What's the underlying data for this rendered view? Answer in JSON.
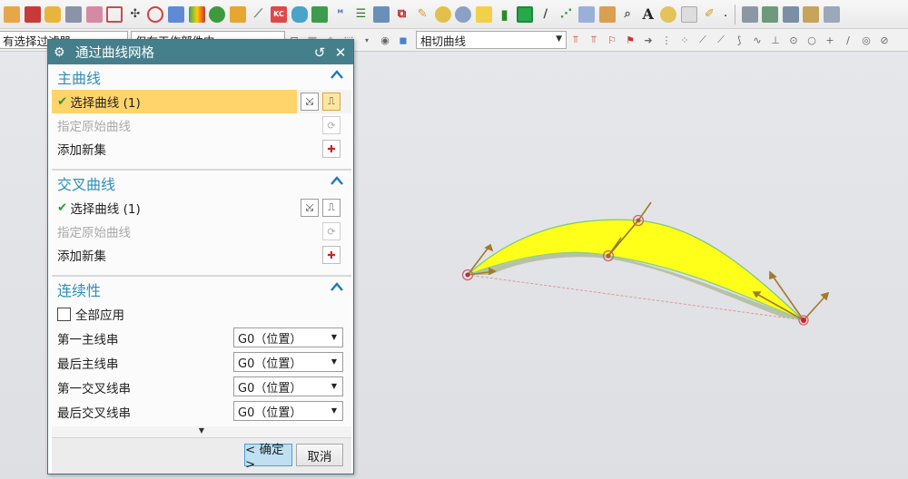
{
  "toolbar_row1": {
    "icons": [
      "feature-icon",
      "block-icon",
      "cylinder-icon",
      "extrude-icon",
      "revolve-icon",
      "sketch-icon",
      "datum-icon",
      "point-icon",
      "bridge-icon",
      "sphere-icon",
      "edge-blend-icon",
      "chamfer-icon",
      "kc-icon",
      "curve-icon",
      "transform-icon",
      "offset-icon",
      "hole-icon",
      "thread-icon",
      "boolean-icon",
      "unite-icon",
      "shell-icon",
      "pattern-icon",
      "mirror-icon",
      "trim-icon",
      "box-icon",
      "rectangle-icon",
      "line-icon",
      "arc-icon",
      "table-icon",
      "surface-icon",
      "analyze-icon",
      "text-icon",
      "paint-icon",
      "view-icon",
      "brush-icon"
    ],
    "text_icon_glyph": "A",
    "right_icons": [
      "layer-icon",
      "layer-stack-icon",
      "layer-settings-icon",
      "view-layer-icon",
      "view-style-icon"
    ]
  },
  "toolbar_row2": {
    "filter_combo": "有选择过滤器",
    "scope_combo": "仅在工作部件内",
    "curve_rule_combo": "相切曲线"
  },
  "dialog": {
    "title": "通过曲线网格",
    "primary_group": {
      "title": "主曲线",
      "select_label": "选择曲线 (1)",
      "origin_label": "指定原始曲线",
      "add_label": "添加新集"
    },
    "cross_group": {
      "title": "交叉曲线",
      "select_label": "选择曲线 (1)",
      "origin_label": "指定原始曲线",
      "add_label": "添加新集"
    },
    "continuity_group": {
      "title": "连续性",
      "apply_all_label": "全部应用",
      "rows": [
        {
          "label": "第一主线串",
          "value": "G0（位置）"
        },
        {
          "label": "最后主线串",
          "value": "G0（位置）"
        },
        {
          "label": "第一交叉线串",
          "value": "G0（位置）"
        },
        {
          "label": "最后交叉线串",
          "value": "G0（位置）"
        }
      ]
    },
    "ok_label": "< 确定 >",
    "cancel_label": "取消"
  },
  "colors": {
    "title_bar": "#467f8c",
    "group_title": "#2c8ebb",
    "selected_row": "#ffd46b",
    "surface_fill": "#ffff1a",
    "ok_button": "#bfe0f3"
  }
}
